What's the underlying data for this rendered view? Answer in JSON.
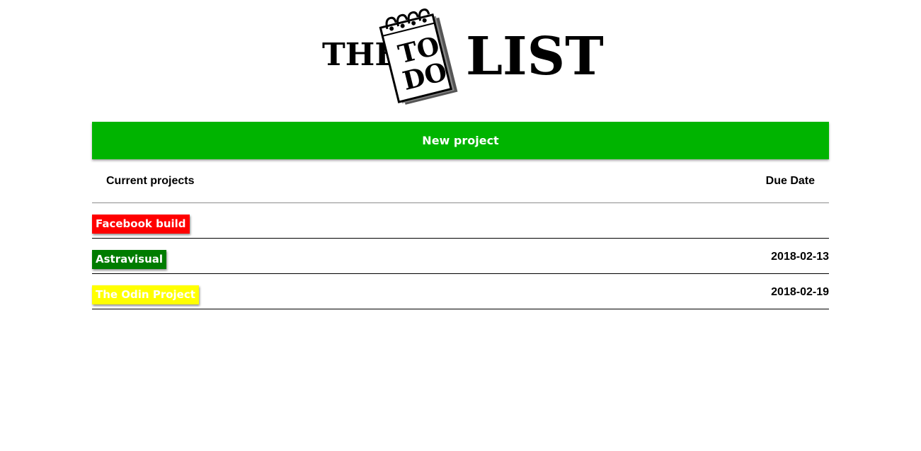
{
  "logo": {
    "word_left": "THE",
    "word_note_1": "TO",
    "word_note_2": "DO",
    "word_right": "LIST"
  },
  "new_project_label": "New project",
  "table_header": {
    "projects_label": "Current projects",
    "due_date_label": "Due Date"
  },
  "projects": [
    {
      "name": "Facebook build",
      "due_date": "",
      "color": "#ff0000"
    },
    {
      "name": "Astravisual",
      "due_date": "2018-02-13",
      "color": "#007c00"
    },
    {
      "name": "The Odin Project",
      "due_date": "2018-02-19",
      "color": "#ffff00"
    }
  ]
}
